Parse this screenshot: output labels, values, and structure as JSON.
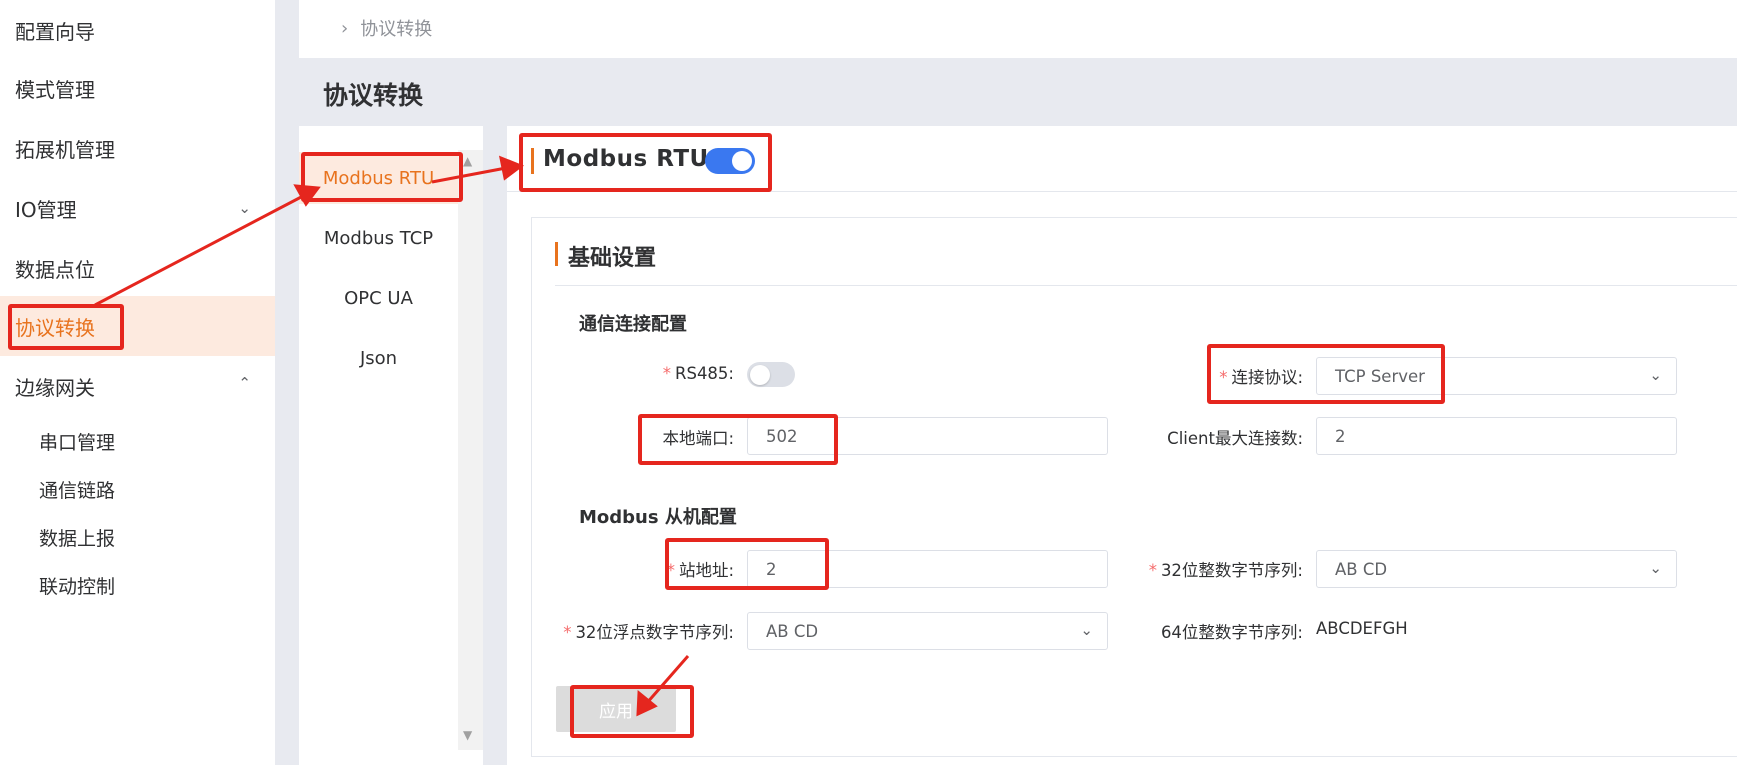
{
  "sidebar": {
    "items": [
      {
        "label": "配置向导"
      },
      {
        "label": "模式管理"
      },
      {
        "label": "拓展机管理"
      },
      {
        "label": "IO管理"
      },
      {
        "label": "数据点位"
      },
      {
        "label": "协议转换"
      },
      {
        "label": "边缘网关"
      }
    ],
    "sub_items": [
      {
        "label": "串口管理"
      },
      {
        "label": "通信链路"
      },
      {
        "label": "数据上报"
      },
      {
        "label": "联动控制"
      }
    ]
  },
  "breadcrumb": {
    "current": "协议转换"
  },
  "page_title": "协议转换",
  "protocols": [
    {
      "label": "Modbus RTU"
    },
    {
      "label": "Modbus TCP"
    },
    {
      "label": "OPC UA"
    },
    {
      "label": "Json"
    }
  ],
  "main": {
    "title": "Modbus RTU",
    "enabled": true,
    "card_title": "基础设置",
    "comm_section": "通信连接配置",
    "slave_section": "Modbus 从机配置",
    "rs485_label": "RS485:",
    "rs485_enabled": false,
    "protocol_label": "连接协议:",
    "protocol_value": "TCP Server",
    "local_port_label": "本地端口:",
    "local_port_value": "502",
    "max_clients_label": "Client最大连接数:",
    "max_clients_value": "2",
    "station_label": "站地址:",
    "station_value": "2",
    "int32_order_label": "32位整数字节序列:",
    "int32_order_value": "AB CD",
    "float32_order_label": "32位浮点数字节序列:",
    "float32_order_value": "AB CD",
    "int64_order_label": "64位整数字节序列:",
    "int64_order_value": "ABCDEFGH",
    "apply_label": "应用"
  },
  "colors": {
    "accent": "#e8731e",
    "active_bg": "#fdeadf",
    "toggle_on": "#3a78f0",
    "annotation": "#e5261e"
  }
}
